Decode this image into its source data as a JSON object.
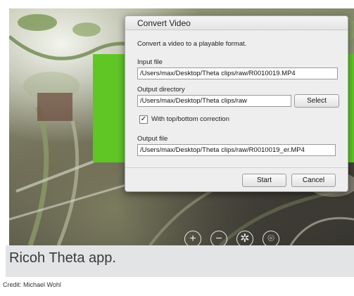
{
  "dialog": {
    "title": "Convert Video",
    "description": "Convert a video to a playable format.",
    "input_label": "Input file",
    "input_value": "/Users/max/Desktop/Theta clips/raw/R0010019.MP4",
    "output_dir_label": "Output directory",
    "output_dir_value": "/Users/max/Desktop/Theta clips/raw",
    "select_label": "Select",
    "correction_checked": true,
    "correction_label": "With top/bottom correction",
    "output_file_label": "Output file",
    "output_file_value": "/Users/max/Desktop/Theta clips/raw/R0010019_er.MP4",
    "start_label": "Start",
    "cancel_label": "Cancel"
  },
  "viewer_controls": [
    "zoom-in-icon",
    "zoom-out-icon",
    "settings-icon",
    "fullscreen-icon"
  ],
  "caption": "Ricoh Theta app.",
  "credit": "Credit: Michael Wohl",
  "colors": {
    "accent_green": "#5fc625",
    "caption_bg": "#e3e4e6"
  }
}
